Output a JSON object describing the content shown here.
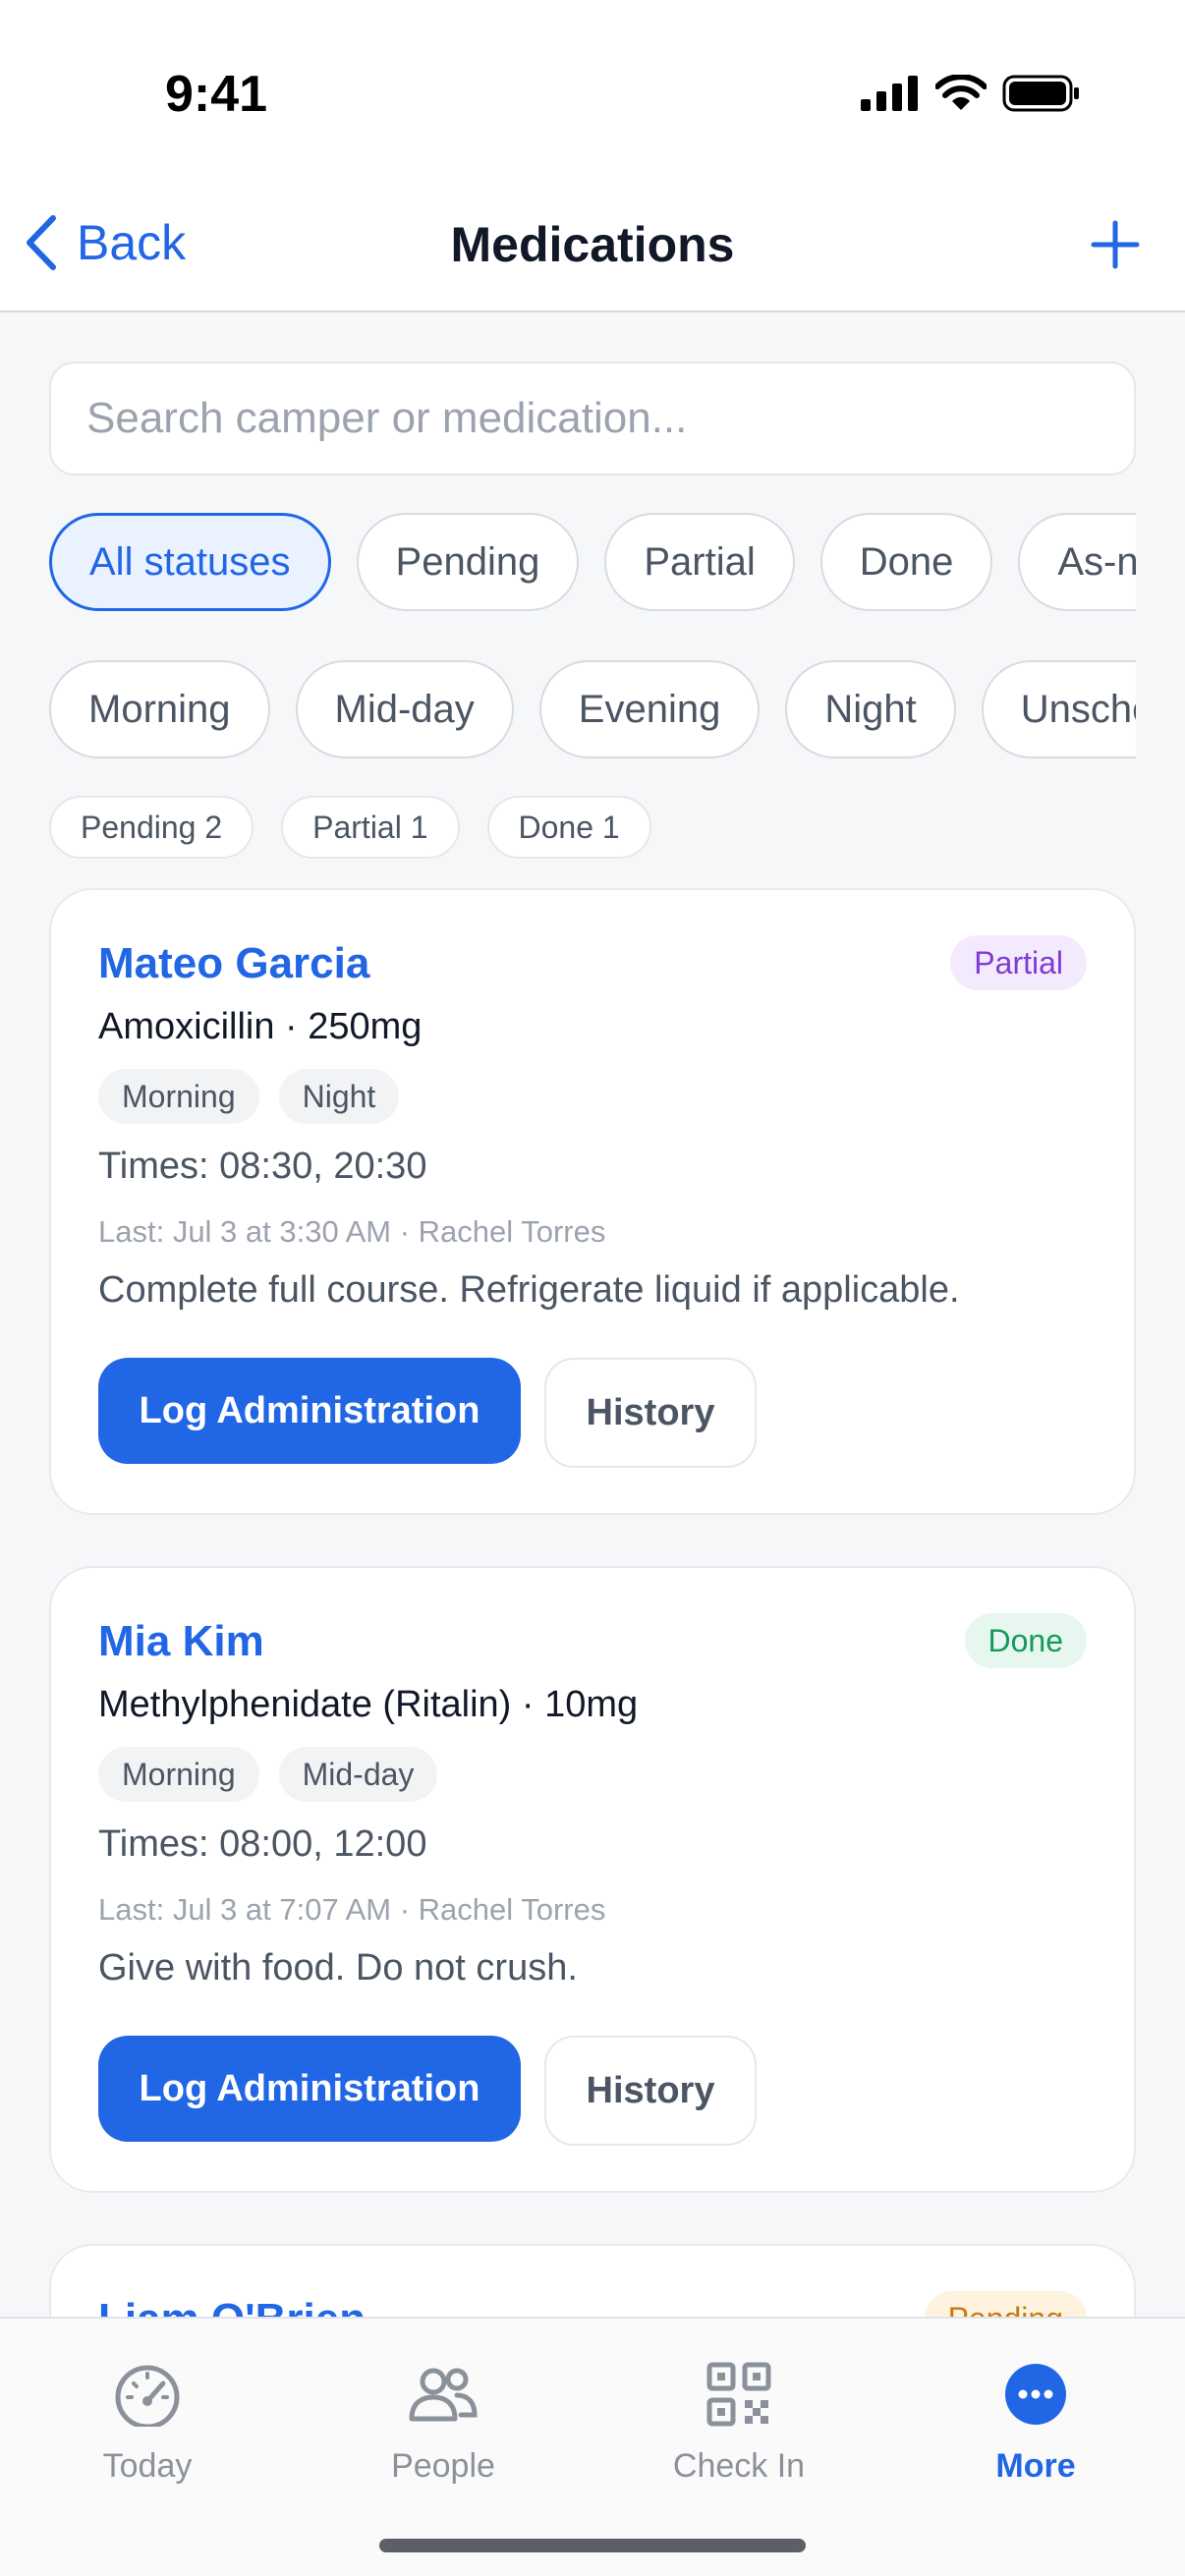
{
  "status_bar": {
    "time": "9:41"
  },
  "nav": {
    "back_label": "Back",
    "title": "Medications"
  },
  "search": {
    "placeholder": "Search camper or medication..."
  },
  "status_filters": [
    {
      "label": "All statuses",
      "active": true
    },
    {
      "label": "Pending",
      "active": false
    },
    {
      "label": "Partial",
      "active": false
    },
    {
      "label": "Done",
      "active": false
    },
    {
      "label": "As-needed",
      "active": false
    }
  ],
  "time_filters": [
    "Morning",
    "Mid-day",
    "Evening",
    "Night",
    "Unscheduled"
  ],
  "counts": [
    "Pending 2",
    "Partial 1",
    "Done 1"
  ],
  "cards": [
    {
      "name": "Mateo Garcia",
      "status": "Partial",
      "medication": "Amoxicillin · 250mg",
      "tags": [
        "Morning",
        "Night"
      ],
      "times": "Times: 08:30, 20:30",
      "last": "Last: Jul 3 at 3:30 AM · Rachel Torres",
      "note": "Complete full course. Refrigerate liquid if applicable.",
      "log_label": "Log Administration",
      "history_label": "History"
    },
    {
      "name": "Mia Kim",
      "status": "Done",
      "medication": "Methylphenidate (Ritalin) · 10mg",
      "tags": [
        "Morning",
        "Mid-day"
      ],
      "times": "Times: 08:00, 12:00",
      "last": "Last: Jul 3 at 7:07 AM · Rachel Torres",
      "note": "Give with food. Do not crush.",
      "log_label": "Log Administration",
      "history_label": "History"
    },
    {
      "name": "Liam O'Brien",
      "status": "Pending"
    }
  ],
  "tab_bar": [
    {
      "label": "Today",
      "icon": "gauge-icon",
      "active": false
    },
    {
      "label": "People",
      "icon": "people-icon",
      "active": false
    },
    {
      "label": "Check In",
      "icon": "qr-code-icon",
      "active": false
    },
    {
      "label": "More",
      "icon": "more-icon",
      "active": true
    }
  ],
  "colors": {
    "accent": "#2166e5",
    "partial": "#7e3bd6",
    "done": "#159a5b",
    "pending": "#c7790f"
  }
}
